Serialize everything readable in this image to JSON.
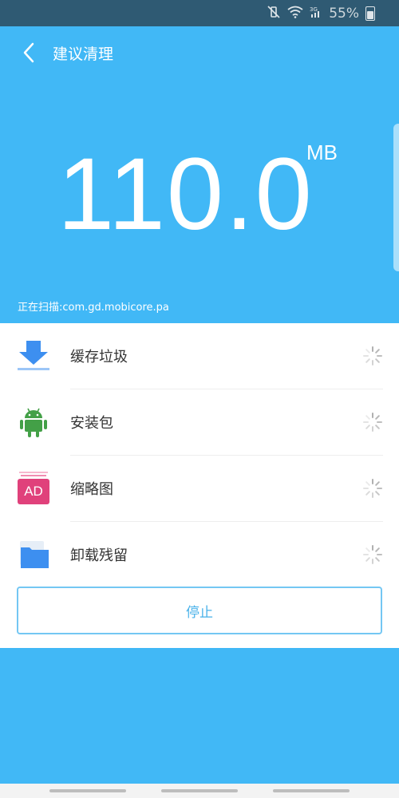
{
  "status_bar": {
    "battery_percent": "55%",
    "icons": [
      "mute-vibrate-icon",
      "wifi-icon",
      "signal-3g-icon",
      "battery-icon"
    ]
  },
  "header": {
    "title": "建议清理",
    "back_icon": "chevron-left-icon"
  },
  "scan": {
    "size_value": "110.0",
    "size_unit": "MB",
    "status_text": "正在扫描:com.gd.mobicore.pa"
  },
  "items": [
    {
      "label": "缓存垃圾",
      "icon": "download-icon"
    },
    {
      "label": "安装包",
      "icon": "android-icon"
    },
    {
      "label": "缩略图",
      "icon": "ad-badge-icon",
      "badge_text": "AD"
    },
    {
      "label": "卸载残留",
      "icon": "folder-icon"
    }
  ],
  "stop_button": {
    "label": "停止"
  },
  "colors": {
    "background": "#41b8f6",
    "status_bar": "#2f5a73",
    "accent": "#48b1e9",
    "ad_badge": "#e0417b",
    "android_green": "#43a047",
    "folder_blue": "#3d8ff0"
  }
}
